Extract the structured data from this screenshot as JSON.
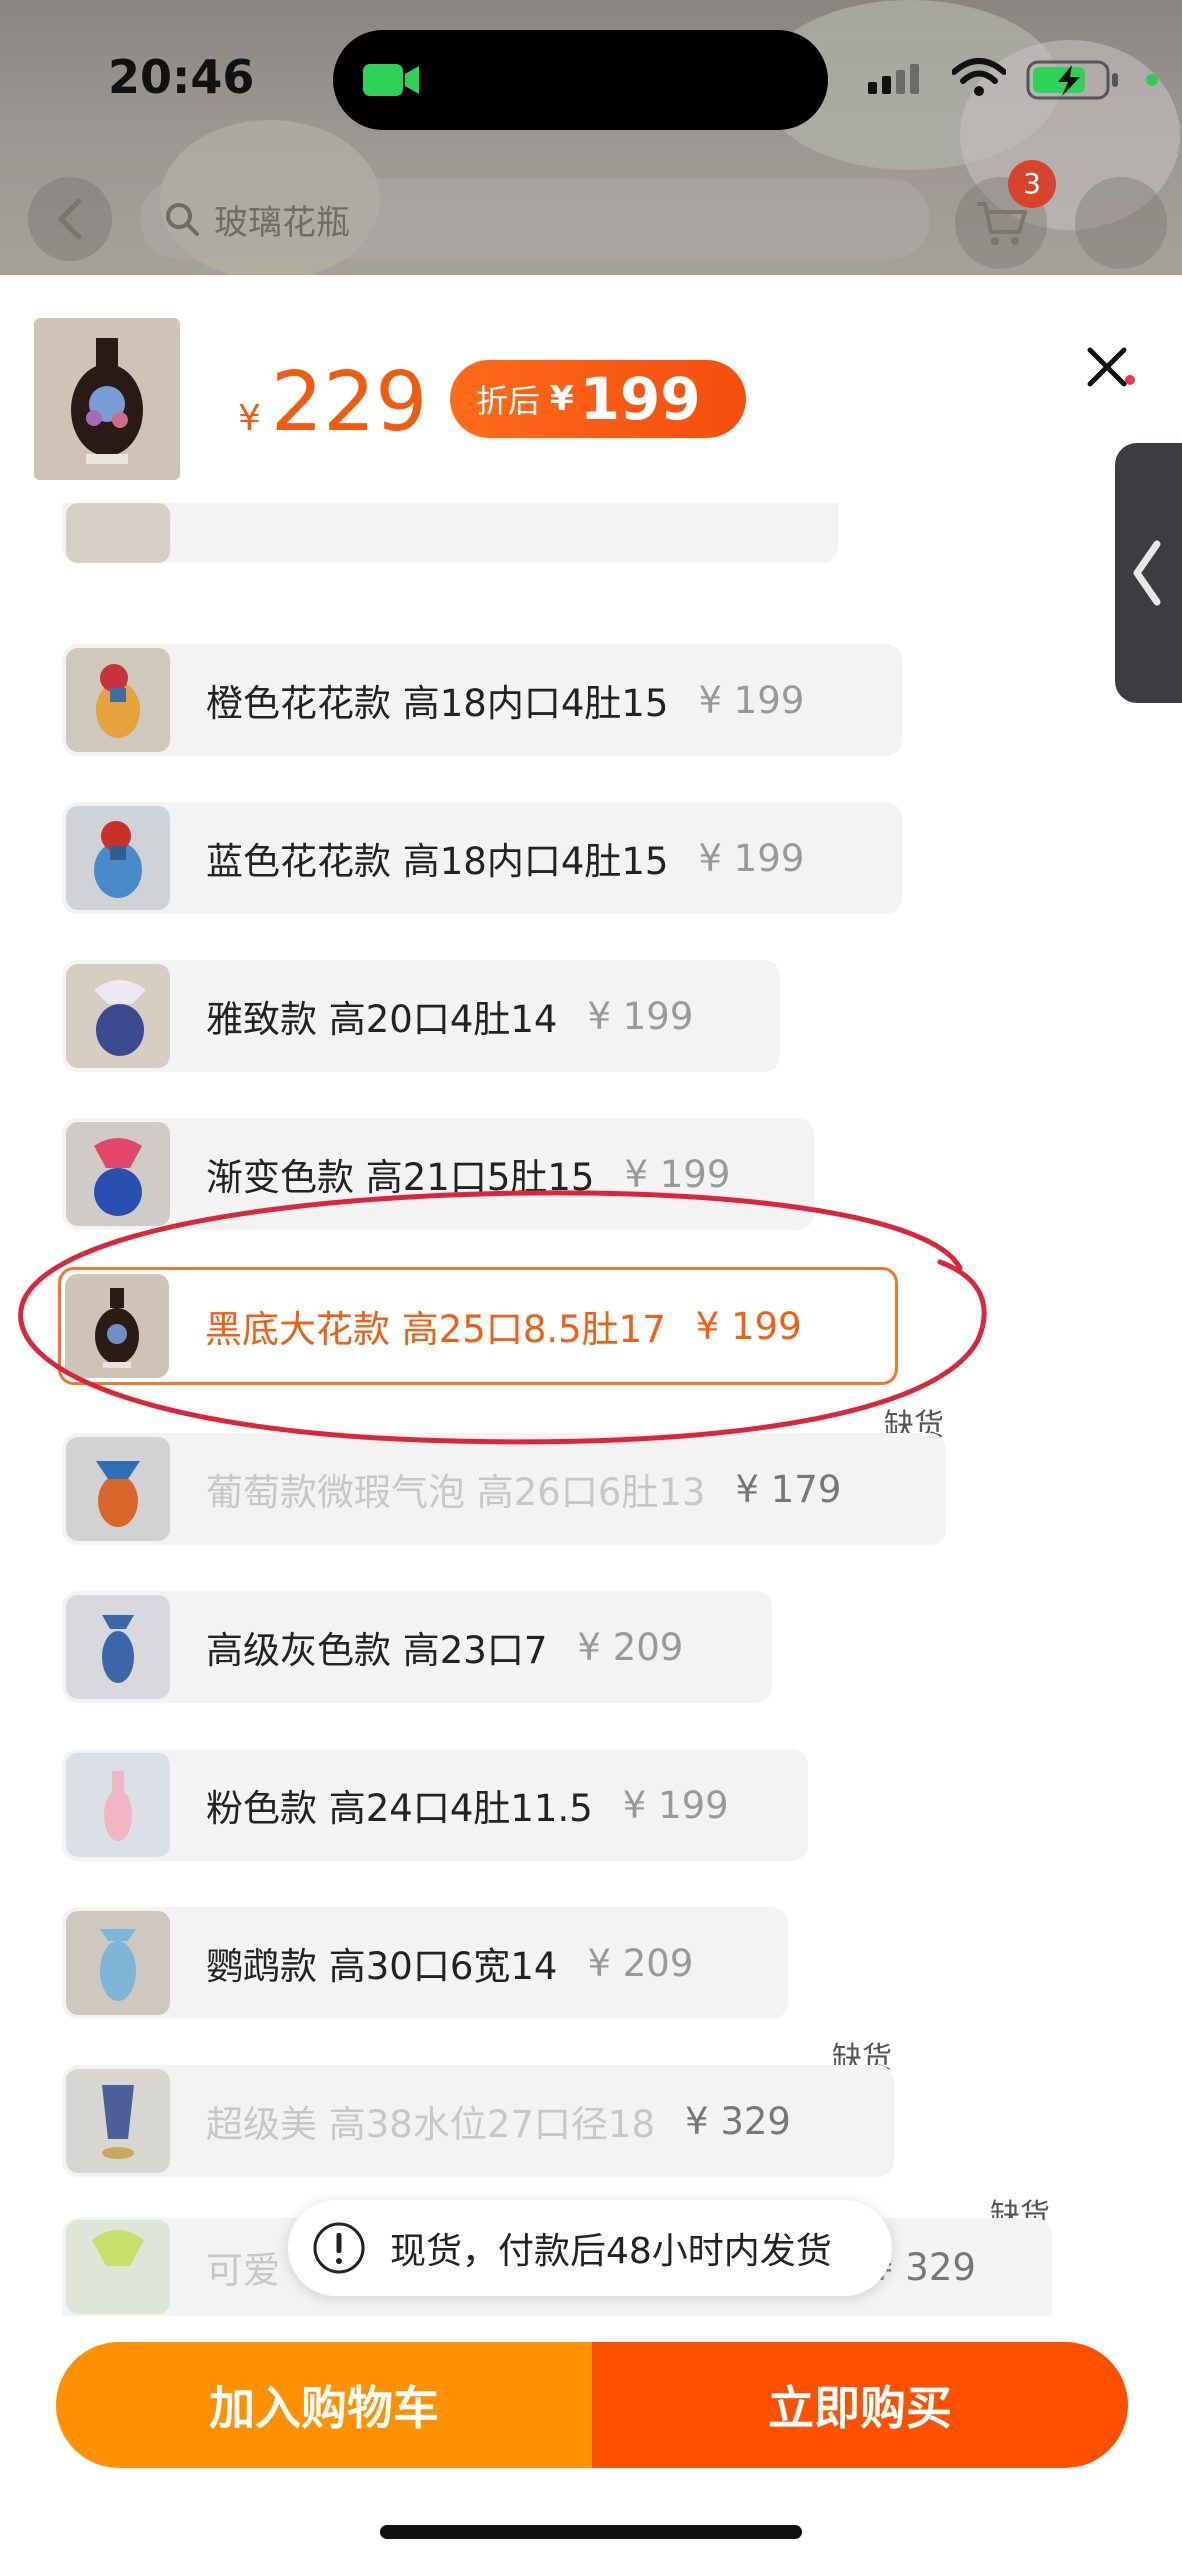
{
  "status_bar": {
    "time": "20:46"
  },
  "header": {
    "search_placeholder": "玻璃花瓶",
    "cart_count": "3"
  },
  "sheet": {
    "currency": "¥",
    "price": "229",
    "discount_label": "折后",
    "discount_currency": "¥",
    "discount_price": "199"
  },
  "options": [
    {
      "label": "橙色花花款 高18内口4肚15",
      "price": "¥ 199",
      "state": "normal"
    },
    {
      "label": "蓝色花花款 高18内口4肚15",
      "price": "¥ 199",
      "state": "normal"
    },
    {
      "label": "雅致款 高20口4肚14",
      "price": "¥ 199",
      "state": "normal"
    },
    {
      "label": "渐变色款 高21口5肚15",
      "price": "¥ 199",
      "state": "normal"
    },
    {
      "label": "黑底大花款 高25口8.5肚17",
      "price": "¥ 199",
      "state": "selected"
    },
    {
      "label": "葡萄款微瑕气泡 高26口6肚13",
      "price": "¥ 179",
      "state": "out_of_stock"
    },
    {
      "label": "高级灰色款 高23口7",
      "price": "¥ 209",
      "state": "normal"
    },
    {
      "label": "粉色款 高24口4肚11.5",
      "price": "¥ 199",
      "state": "normal"
    },
    {
      "label": "鹦鹉款 高30口6宽14",
      "price": "¥ 209",
      "state": "normal"
    },
    {
      "label": "超级美 高38水位27口径18",
      "price": "¥ 329",
      "state": "out_of_stock"
    },
    {
      "label": "可爱",
      "price": "¥ 329",
      "state": "out_of_stock"
    }
  ],
  "out_of_stock_label": "缺货",
  "toast": {
    "text": "现货，付款后48小时内发货"
  },
  "actions": {
    "add_to_cart": "加入购物车",
    "buy_now": "立即购买"
  },
  "colors": {
    "accent": "#f15a0f",
    "cart_button": "#ff9000",
    "buy_button": "#ff5000",
    "annotation_circle": "#d9263b"
  }
}
